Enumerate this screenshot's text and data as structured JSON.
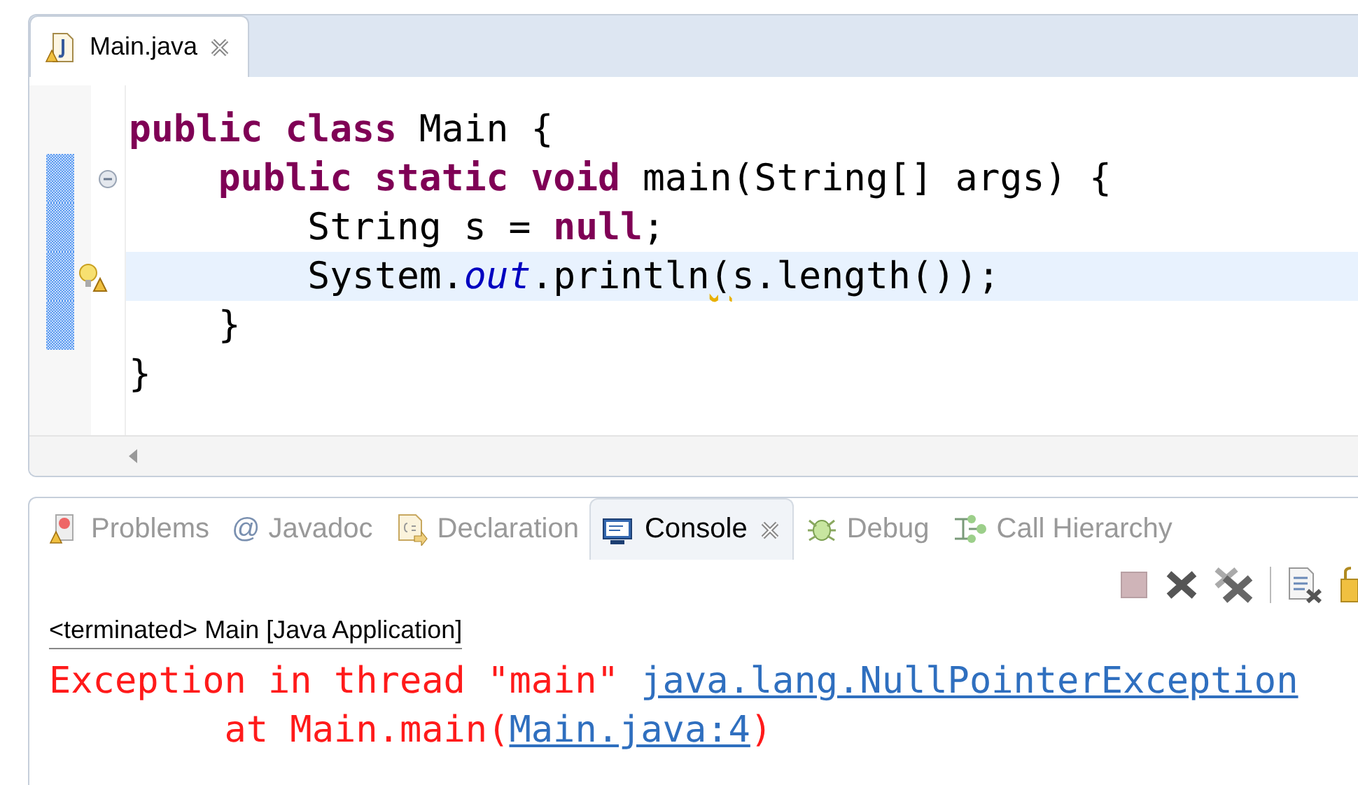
{
  "editor": {
    "tab": {
      "label": "Main.java",
      "selected": true
    },
    "lines": [
      {
        "highlighted": false,
        "in_range": false,
        "fold": false,
        "warning": false,
        "tokens": [
          {
            "kind": "keyword",
            "text": "public"
          },
          {
            "kind": "keyword",
            "text": " class"
          },
          {
            "kind": "plain",
            "text": " Main {"
          }
        ]
      },
      {
        "highlighted": false,
        "in_range": true,
        "fold": true,
        "warning": false,
        "tokens": [
          {
            "kind": "keyword",
            "text": "    public"
          },
          {
            "kind": "keyword",
            "text": " static"
          },
          {
            "kind": "keyword",
            "text": " void"
          },
          {
            "kind": "plain",
            "text": " main(String[] args) {"
          }
        ]
      },
      {
        "highlighted": false,
        "in_range": true,
        "fold": false,
        "warning": false,
        "tokens": [
          {
            "kind": "plain",
            "text": "        String s = "
          },
          {
            "kind": "keyword",
            "text": "null"
          },
          {
            "kind": "plain",
            "text": ";"
          }
        ]
      },
      {
        "highlighted": true,
        "in_range": true,
        "fold": false,
        "warning": true,
        "tokens": [
          {
            "kind": "plain",
            "text": "        System."
          },
          {
            "kind": "field",
            "text": "out"
          },
          {
            "kind": "plain",
            "text": ".println"
          },
          {
            "kind": "squiggle",
            "text": "("
          },
          {
            "kind": "plain",
            "text": "s.length());"
          }
        ]
      },
      {
        "highlighted": false,
        "in_range": true,
        "fold": false,
        "warning": false,
        "tokens": [
          {
            "kind": "plain",
            "text": "    }"
          }
        ]
      },
      {
        "highlighted": false,
        "in_range": false,
        "fold": false,
        "warning": false,
        "tokens": [
          {
            "kind": "plain",
            "text": "}"
          }
        ]
      }
    ]
  },
  "console": {
    "tabs": [
      {
        "kind": "problems",
        "label": "Problems",
        "selected": false
      },
      {
        "kind": "glyph",
        "glyph": "@",
        "label": "Javadoc",
        "selected": false
      },
      {
        "kind": "declaration",
        "label": "Declaration",
        "selected": false
      },
      {
        "kind": "console",
        "label": "Console",
        "selected": true
      },
      {
        "kind": "debug",
        "label": "Debug",
        "selected": false
      },
      {
        "kind": "hierarchy",
        "label": "Call Hierarchy",
        "selected": false
      }
    ],
    "status": "<terminated> Main [Java Application]",
    "output": [
      {
        "tokens": [
          {
            "kind": "error",
            "text": "Exception in thread \"main\" "
          },
          {
            "kind": "link",
            "text": "java.lang.NullPointerException"
          }
        ]
      },
      {
        "tokens": [
          {
            "kind": "error",
            "text": "        at Main.main("
          },
          {
            "kind": "link",
            "text": "Main.java:4"
          },
          {
            "kind": "error",
            "text": ")"
          }
        ]
      }
    ]
  }
}
